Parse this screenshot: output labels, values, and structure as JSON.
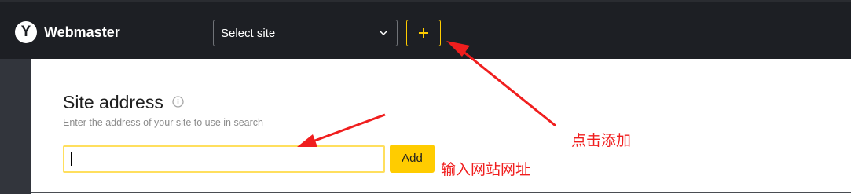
{
  "header": {
    "logo_letter": "Y",
    "brand": "Webmaster",
    "site_select_label": "Select site",
    "add_site_icon": "plus-icon"
  },
  "form": {
    "title": "Site address",
    "title_icon": "info-icon",
    "hint": "Enter the address of your site to use in search",
    "input_value": "",
    "add_button_label": "Add"
  },
  "annotations": {
    "click_add": "点击添加",
    "enter_site": "输入网站网址"
  },
  "colors": {
    "header_bg": "#1d1f24",
    "accent": "#ffcc00",
    "annotation": "#f01e1e"
  }
}
